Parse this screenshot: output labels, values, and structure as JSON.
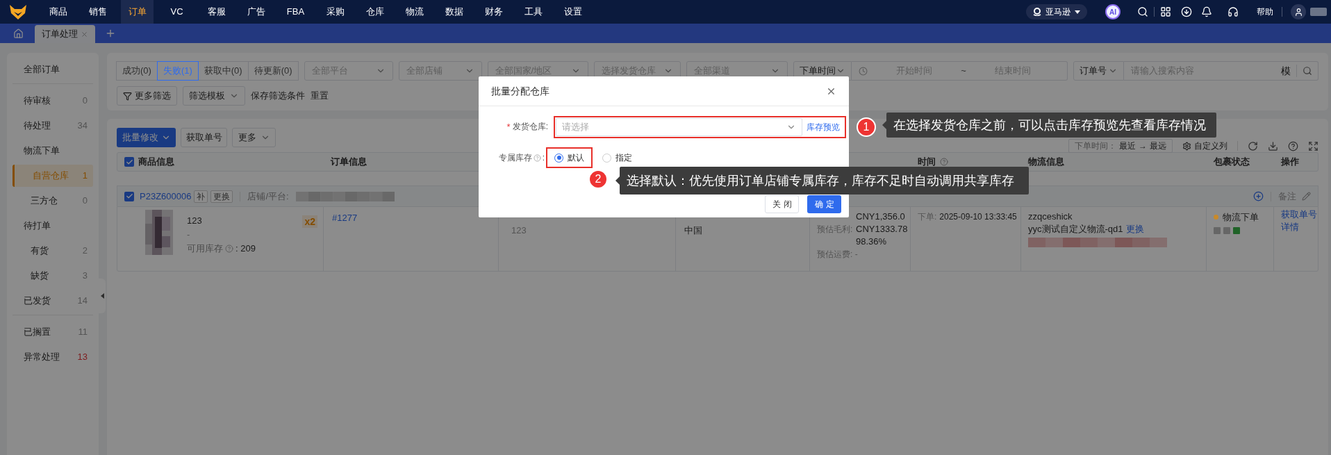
{
  "nav": {
    "menu": [
      {
        "label": "商品",
        "selected": false
      },
      {
        "label": "销售",
        "selected": false
      },
      {
        "label": "订单",
        "selected": true
      },
      {
        "label": "VC",
        "selected": false
      },
      {
        "label": "客服",
        "selected": false
      },
      {
        "label": "广告",
        "selected": false
      },
      {
        "label": "FBA",
        "selected": false
      },
      {
        "label": "采购",
        "selected": false
      },
      {
        "label": "仓库",
        "selected": false
      },
      {
        "label": "物流",
        "selected": false
      },
      {
        "label": "数据",
        "selected": false
      },
      {
        "label": "财务",
        "selected": false
      },
      {
        "label": "工具",
        "selected": false
      },
      {
        "label": "设置",
        "selected": false
      }
    ],
    "marketplace": "亚马逊",
    "ai_badge": "AI",
    "help": "帮助"
  },
  "tabs": [
    {
      "label": "订单处理",
      "selected": true
    }
  ],
  "sidebar": {
    "groups": [
      {
        "items": [
          {
            "label": "全部订单",
            "selected": false,
            "alert": false
          }
        ]
      },
      {
        "items": [
          {
            "label": "待审核",
            "count": "0",
            "selected": false,
            "alert": false
          },
          {
            "label": "待处理",
            "count": "34",
            "selected": false,
            "alert": false
          },
          {
            "label": "物流下单",
            "selected": false,
            "alert": false,
            "children": [
              {
                "label": "自营仓库",
                "count": "1",
                "selected": true,
                "alert": false
              },
              {
                "label": "三方仓",
                "count": "0",
                "selected": false,
                "alert": false
              }
            ]
          },
          {
            "label": "待打单",
            "selected": false,
            "alert": false,
            "children": [
              {
                "label": "有货",
                "count": "2",
                "selected": false,
                "alert": false
              },
              {
                "label": "缺货",
                "count": "3",
                "selected": false,
                "alert": false
              }
            ]
          },
          {
            "label": "已发货",
            "count": "14",
            "selected": false,
            "alert": false
          }
        ]
      },
      {
        "items": [
          {
            "label": "已搁置",
            "count": "11",
            "selected": false,
            "alert": false
          },
          {
            "label": "异常处理",
            "count": "13",
            "selected": false,
            "alert": true
          }
        ]
      }
    ]
  },
  "filters": {
    "status_tabs": [
      {
        "label": "成功(0)",
        "selected": false
      },
      {
        "label": "失败(1)",
        "selected": true
      },
      {
        "label": "获取中(0)",
        "selected": false
      },
      {
        "label": "待更新(0)",
        "selected": false
      }
    ],
    "selects": [
      {
        "placeholder": "全部平台"
      },
      {
        "placeholder": "全部店铺"
      },
      {
        "placeholder": "全部国家/地区"
      },
      {
        "placeholder": "选择发货仓库"
      },
      {
        "placeholder": "全部渠道"
      }
    ],
    "date": {
      "field": "下单时间",
      "start_placeholder": "开始时间",
      "separator": "~",
      "end_placeholder": "结束时间"
    },
    "search": {
      "field": "订单号",
      "placeholder": "请输入搜索内容",
      "mode": "模"
    },
    "actions": {
      "more_filters": "更多筛选",
      "template": "筛选模板",
      "save": "保存筛选条件",
      "reset": "重置"
    }
  },
  "toolbar": {
    "primary": "批量修改",
    "get_number": "获取单号",
    "more": "更多",
    "sort": {
      "label": "下单时间：",
      "from": "最近",
      "arrow": "→",
      "to": "最远"
    },
    "columns": "自定义列"
  },
  "table": {
    "header_checked": true,
    "columns": [
      {
        "label": "商品信息"
      },
      {
        "label": "订单信息"
      },
      {},
      {},
      {},
      {
        "label": "时间",
        "help": true
      },
      {
        "label": "物流信息"
      },
      {
        "label": "包裹状态"
      },
      {
        "label": "操作"
      }
    ],
    "rows": [
      {
        "checked": true,
        "order_no": "P23Z600006",
        "tags": [
          "补",
          "更换"
        ],
        "store_label": "店铺/平台:",
        "note": "备注",
        "product": {
          "name": "123",
          "sub": "-",
          "stock_label": "可用库存",
          "stock": ": 209",
          "qty": "x2"
        },
        "order": "#1277",
        "column_3": [
          "123"
        ],
        "column_4": [
          "中国"
        ],
        "amounts": [
          {
            "value": "CNY1,356.0"
          },
          {
            "label": "预估毛利:",
            "value": "CNY1333.78",
            "rate": "98.36%"
          },
          {
            "note": "预估运费: -"
          }
        ],
        "time": {
          "label": "下单:",
          "value": "2025-09-10 13:33:45"
        },
        "logistics": {
          "account": "zzqceshick",
          "channel": "yyc测试自定义物流-qd1",
          "change": "更换"
        },
        "status": {
          "label": "物流下单",
          "color": "#c98a2a"
        },
        "actions": [
          "获取单号",
          "详情"
        ]
      }
    ]
  },
  "modal": {
    "title": "批量分配仓库",
    "warehouse": {
      "label": "发货仓库:",
      "required_mark": "*",
      "placeholder": "请选择",
      "link": "库存预览"
    },
    "exclusive": {
      "label": "专属库存",
      "colon": ":",
      "options": [
        {
          "label": "默认",
          "selected": true
        },
        {
          "label": "指定",
          "selected": false
        }
      ]
    },
    "buttons": [
      {
        "label": "关闭",
        "kind": "default"
      },
      {
        "label": "确定",
        "kind": "primary"
      }
    ]
  },
  "annotations": [
    {
      "number": "1",
      "text": "在选择发货仓库之前，可以点击库存预览先查看库存情况"
    },
    {
      "number": "2",
      "text": "选择默认：优先使用订单店铺专属库存，库存不足时自动调用共享库存"
    }
  ]
}
